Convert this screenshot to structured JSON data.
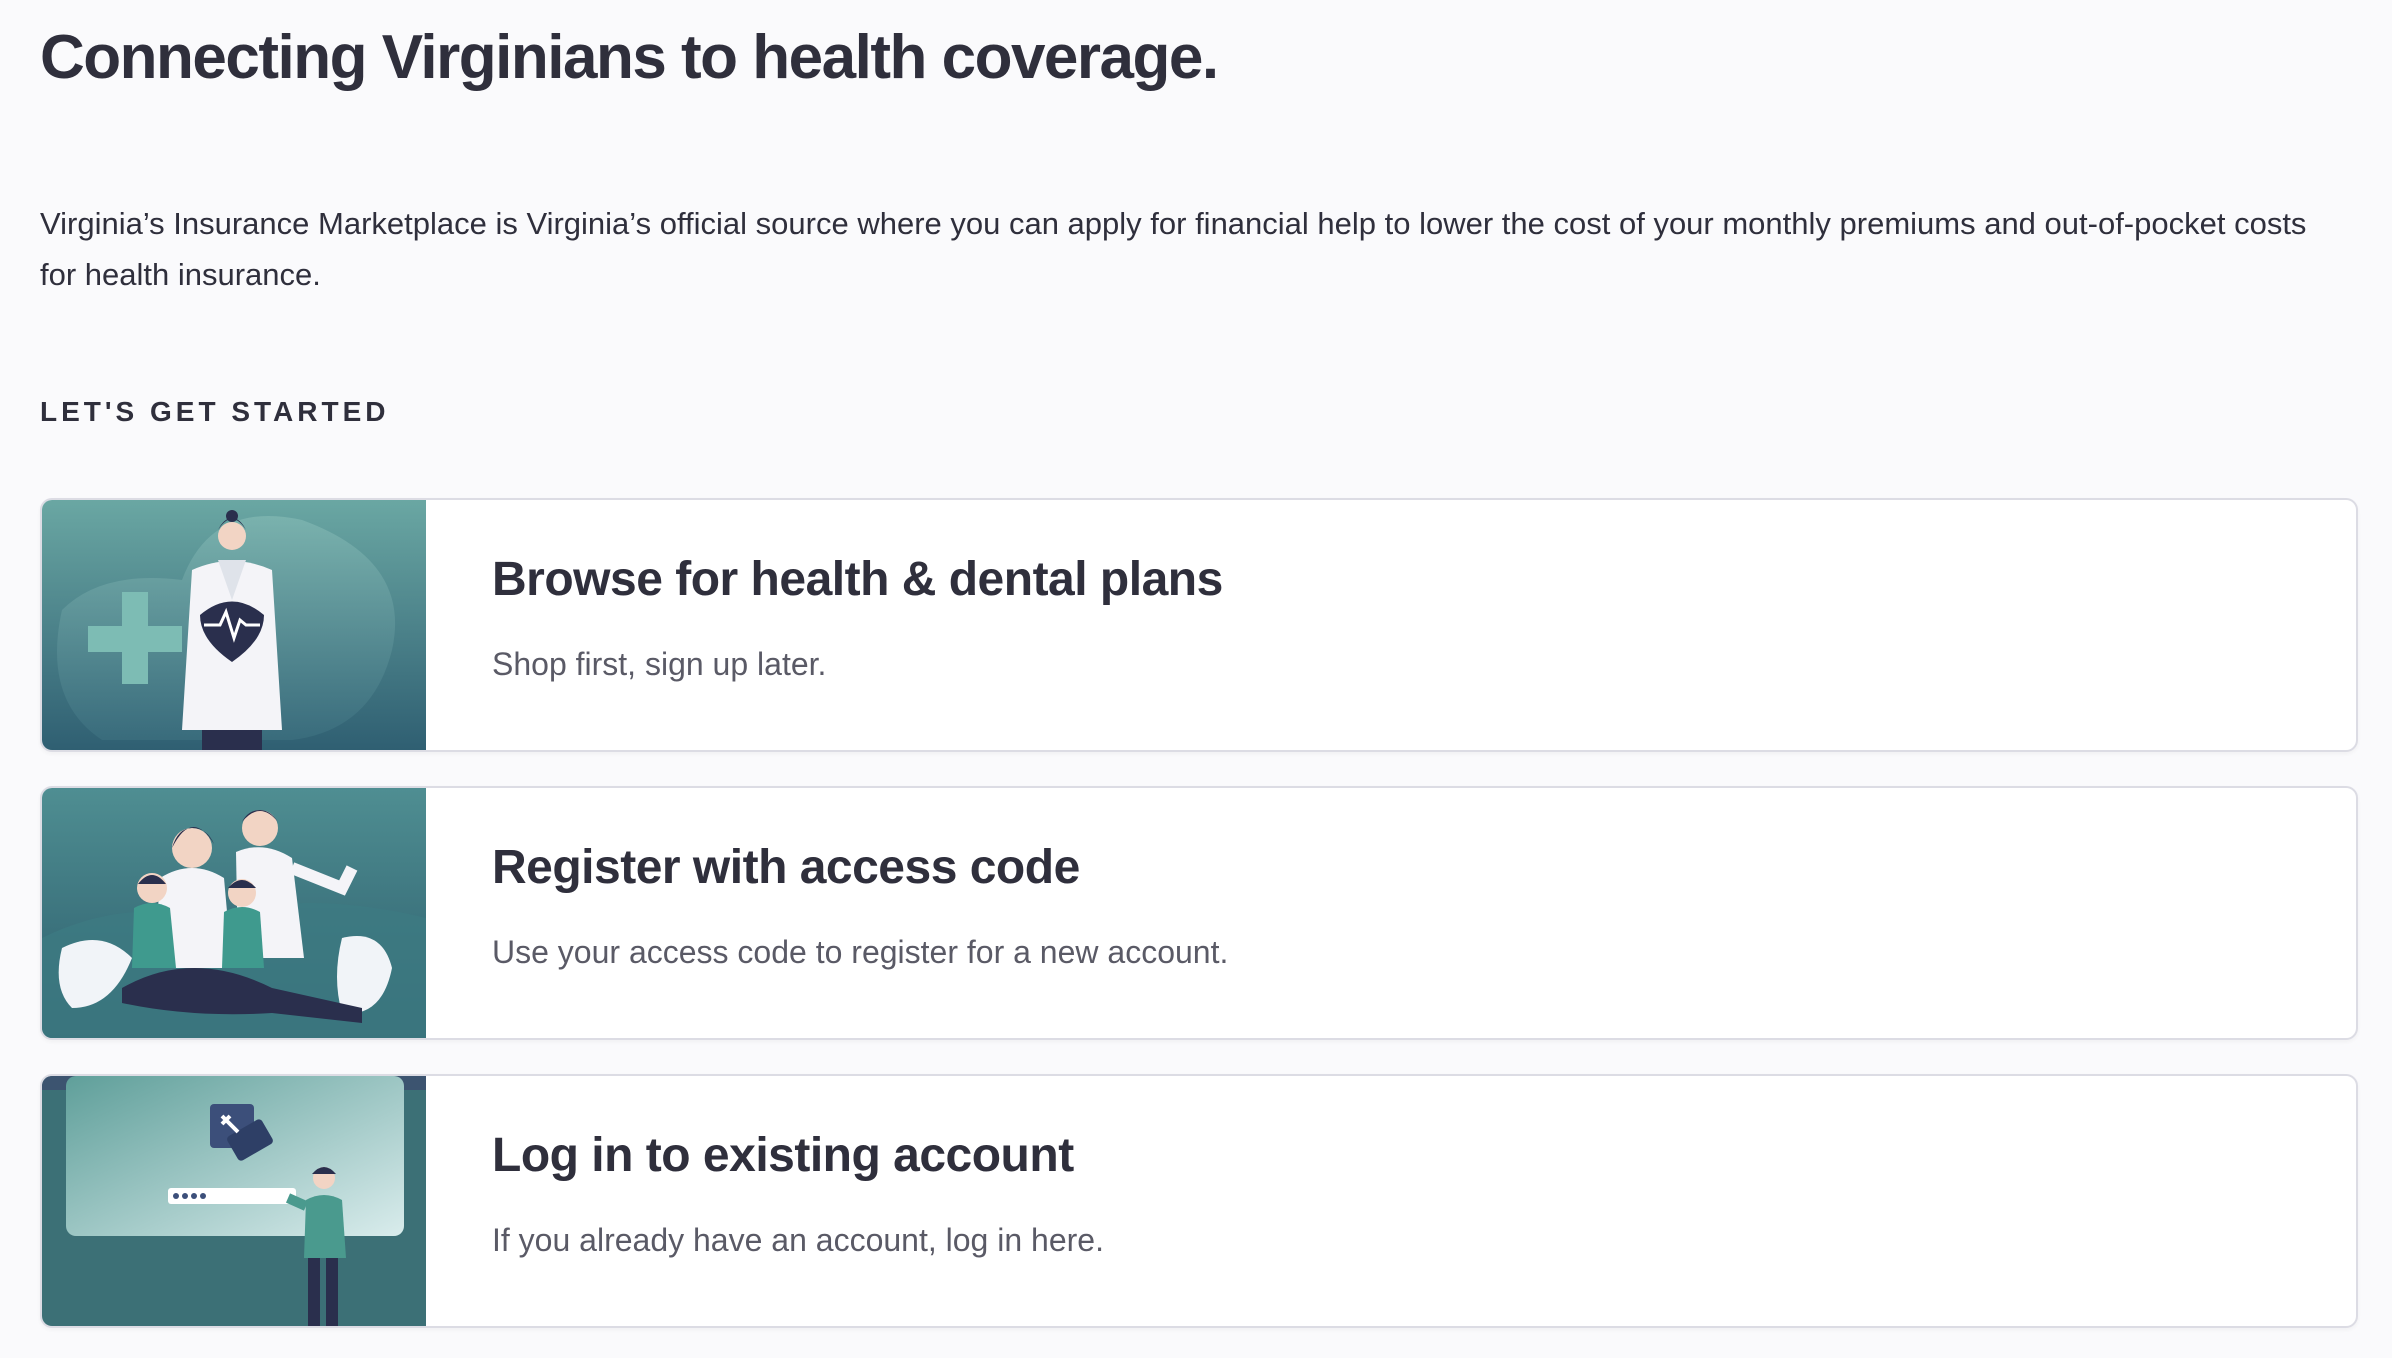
{
  "page": {
    "title": "Connecting Virginians to health coverage.",
    "intro": "Virginia’s Insurance Marketplace is Virginia’s official source where you can apply for financial help to lower the cost of your monthly premiums and out-of-pocket costs for health insurance.",
    "section_label": "LET'S GET STARTED"
  },
  "cards": [
    {
      "title": "Browse for health & dental plans",
      "description": "Shop first, sign up later.",
      "image": "doctor-illustration"
    },
    {
      "title": "Register with access code",
      "description": "Use your access code to register for a new account.",
      "image": "family-illustration"
    },
    {
      "title": "Log in to existing account",
      "description": "If you already have an account, log in here.",
      "image": "login-illustration"
    }
  ],
  "colors": {
    "text": "#2f2f3c",
    "muted_text": "#5a5a66",
    "teal": "#3f8a8a",
    "navy": "#2a2f4d",
    "background": "#fafafc"
  }
}
